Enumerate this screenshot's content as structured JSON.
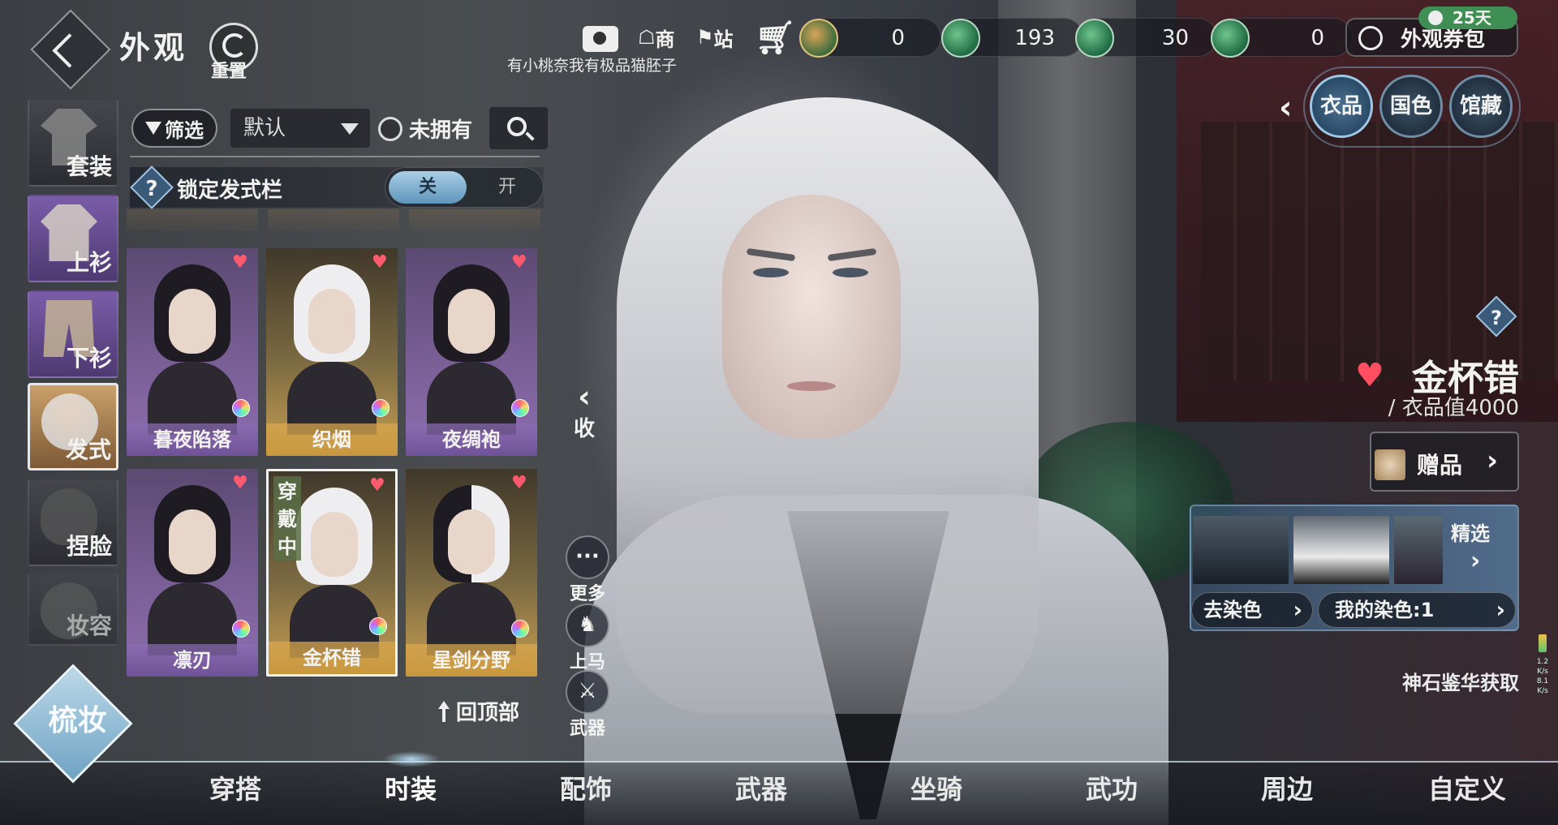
{
  "header": {
    "title": "外观",
    "reset_label": "重置",
    "marquee": "有小桃奈我有极品猫胚子",
    "shop_label": "商",
    "station_label": "站",
    "currencies": [
      {
        "name": "gold-jade",
        "value": "0"
      },
      {
        "name": "green-jade",
        "value": "193"
      },
      {
        "name": "green-jade-2",
        "value": "30"
      },
      {
        "name": "green-jade-3",
        "value": "0"
      }
    ],
    "voucher_label": "外观券包",
    "days_label": "25天"
  },
  "right_tabs": [
    {
      "label": "衣品",
      "active": true
    },
    {
      "label": "国色",
      "active": false
    },
    {
      "label": "馆藏",
      "active": false
    }
  ],
  "categories": [
    {
      "label": "套装"
    },
    {
      "label": "上衫"
    },
    {
      "label": "下衫"
    },
    {
      "label": "发式",
      "active": true
    },
    {
      "label": "捏脸"
    },
    {
      "label": "妆容"
    }
  ],
  "filter": {
    "filter_label": "筛选",
    "sort_value": "默认",
    "unowned_label": "未拥有"
  },
  "lock_row": {
    "help": "?",
    "label": "锁定发式栏",
    "off": "关",
    "on": "开"
  },
  "cards": [
    {
      "name": "暮夜陷落",
      "style": "purple",
      "hair": "black"
    },
    {
      "name": "织烟",
      "style": "gold",
      "hair": "white"
    },
    {
      "name": "夜绸袍",
      "style": "purple",
      "hair": "black"
    },
    {
      "name": "凛刃",
      "style": "purple",
      "hair": "black"
    },
    {
      "name": "金杯错",
      "style": "gold",
      "hair": "white",
      "wearing": "穿戴中",
      "selected": true
    },
    {
      "name": "星剑分野",
      "style": "gold",
      "hair": "mixed"
    }
  ],
  "back_top_label": "回顶部",
  "collapse_label": "收",
  "side_actions": [
    {
      "label": "更多",
      "icon": "···"
    },
    {
      "label": "上马",
      "icon": "♞"
    },
    {
      "label": "武器",
      "icon": "⚔"
    }
  ],
  "item": {
    "help": "?",
    "name": "金杯错",
    "value": "/ 衣品值4000",
    "gift_label": "赠品"
  },
  "dye": {
    "featured_label": "精选",
    "remove_label": "去染色",
    "my_dye_label": "我的染色:1"
  },
  "source_label": "神石鉴华获取",
  "net": {
    "l1": "1.2",
    "l2": "K/s",
    "l3": "8.1",
    "l4": "K/s"
  },
  "bottom_nav": [
    {
      "label": "穿搭"
    },
    {
      "label": "时装",
      "active": true
    },
    {
      "label": "配饰"
    },
    {
      "label": "武器"
    },
    {
      "label": "坐骑"
    },
    {
      "label": "武功"
    },
    {
      "label": "周边"
    },
    {
      "label": "自定义"
    }
  ],
  "makeup_label": "梳妆",
  "colors": {
    "heart": "#ff4e62",
    "accent_blue": "#5f95ba",
    "purple_card": "#7a5f96",
    "gold_card": "#c79f52"
  }
}
